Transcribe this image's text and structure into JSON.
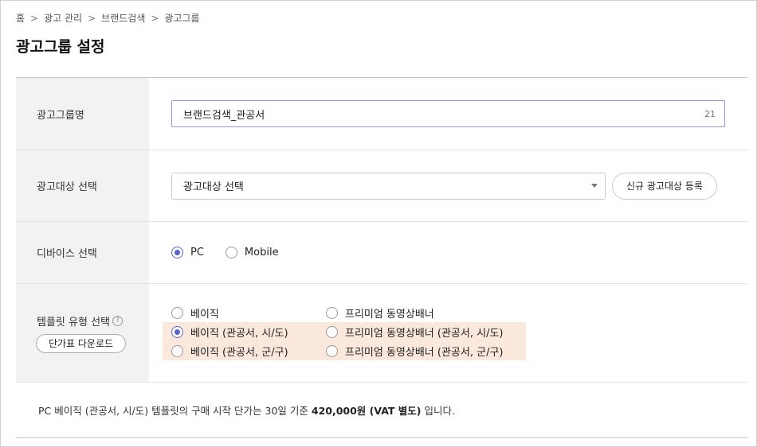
{
  "breadcrumb": {
    "items": [
      "홈",
      "광고 관리",
      "브랜드검색",
      "광고그룹"
    ],
    "separator": ">"
  },
  "page_title": "광고그룹 설정",
  "form": {
    "group_name": {
      "label": "광고그룹명",
      "value": "브랜드검색_관공서",
      "char_count": "21"
    },
    "target": {
      "label": "광고대상 선택",
      "select_value": "광고대상 선택",
      "register_button": "신규 광고대상 등록"
    },
    "device": {
      "label": "디바이스 선택",
      "options": [
        {
          "label": "PC",
          "checked": true
        },
        {
          "label": "Mobile",
          "checked": false
        }
      ]
    },
    "template": {
      "label": "템플릿 유형 선택",
      "help_icon": "?",
      "download_button": "단가표 다운로드",
      "options": [
        {
          "label": "베이직",
          "checked": false,
          "highlight": false
        },
        {
          "label": "프리미엄 동영상배너",
          "checked": false,
          "highlight": false
        },
        {
          "label": "베이직 (관공서, 시/도)",
          "checked": true,
          "highlight": true
        },
        {
          "label": "프리미엄 동영상배너 (관공서, 시/도)",
          "checked": false,
          "highlight": true
        },
        {
          "label": "베이직 (관공서, 군/구)",
          "checked": false,
          "highlight": true
        },
        {
          "label": "프리미엄 동영상배너 (관공서, 군/구)",
          "checked": false,
          "highlight": true
        }
      ]
    }
  },
  "notice": {
    "prefix": "PC 베이직 (관공서, 시/도) 템플릿의 구매 시작 단가는 30일 기준",
    "price": "420,000원 (VAT 별도)",
    "suffix": "입니다."
  },
  "colors": {
    "accent": "#5a62d6",
    "highlight_bg": "#fbe8dd",
    "label_bg": "#f2f2f2"
  }
}
